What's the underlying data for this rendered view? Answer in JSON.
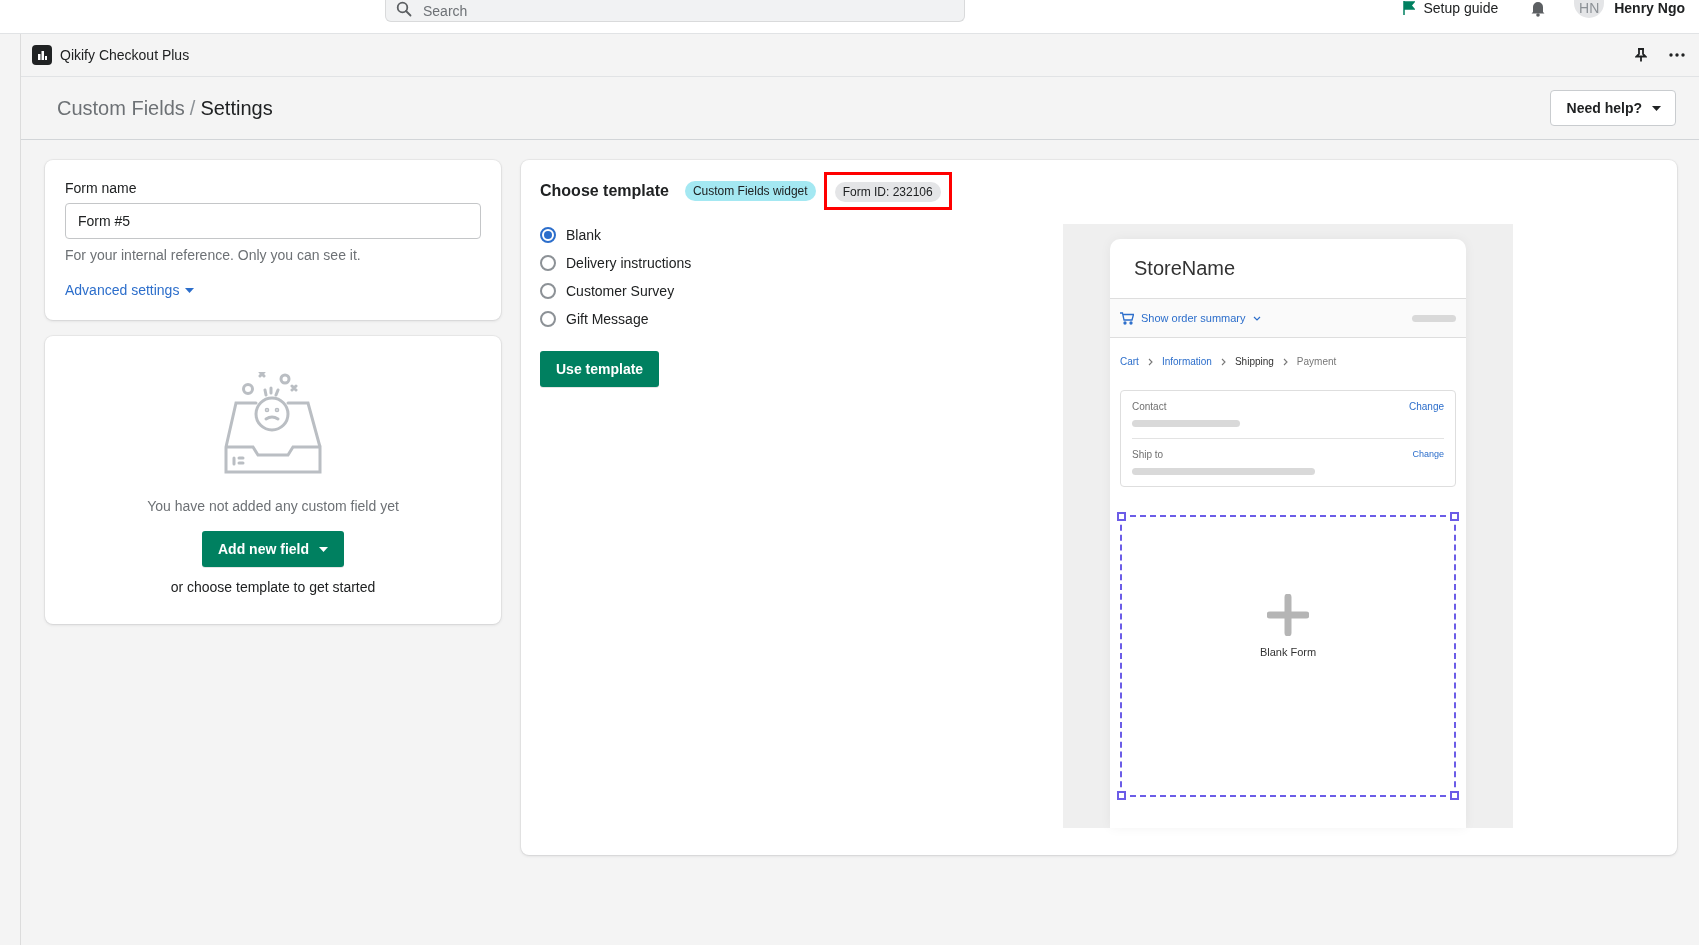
{
  "top_bar": {
    "search": {
      "placeholder": "Search"
    },
    "setup_guide": "Setup guide",
    "avatar_initials": "HN",
    "user_name": "Henry Ngo"
  },
  "app_bar": {
    "title": "Qikify Checkout Plus"
  },
  "breadcrumb": [
    {
      "label": "Custom Fields"
    },
    {
      "label": "Settings"
    }
  ],
  "breadcrumb_separator": "/",
  "need_help": "Need help?",
  "form_card": {
    "label": "Form name",
    "value": "Form #5",
    "help": "For your internal reference. Only you can see it.",
    "advanced": "Advanced settings"
  },
  "empty_state": {
    "message": "You have not added any custom field yet",
    "button": "Add new field",
    "hint": "or choose template to get started"
  },
  "template_card": {
    "title": "Choose template",
    "badges": [
      {
        "label": "Custom Fields widget",
        "kind": "info",
        "highlighted": false
      },
      {
        "label": "Form ID: 232106",
        "kind": "neutral",
        "highlighted": true
      }
    ],
    "options": [
      {
        "label": "Blank",
        "selected": true
      },
      {
        "label": "Delivery instructions",
        "selected": false
      },
      {
        "label": "Customer Survey",
        "selected": false
      },
      {
        "label": "Gift Message",
        "selected": false
      }
    ],
    "button": "Use template"
  },
  "preview": {
    "store_name": "StoreName",
    "summary": "Show order summary",
    "steps": [
      {
        "label": "Cart",
        "kind": "link"
      },
      {
        "label": "Information",
        "kind": "link"
      },
      {
        "label": "Shipping",
        "kind": "current"
      },
      {
        "label": "Payment",
        "kind": "upcoming"
      }
    ],
    "sections": [
      {
        "label": "Contact",
        "action": "Change"
      },
      {
        "label": "Ship to",
        "action": "Change"
      }
    ],
    "blank_form": "Blank Form"
  }
}
